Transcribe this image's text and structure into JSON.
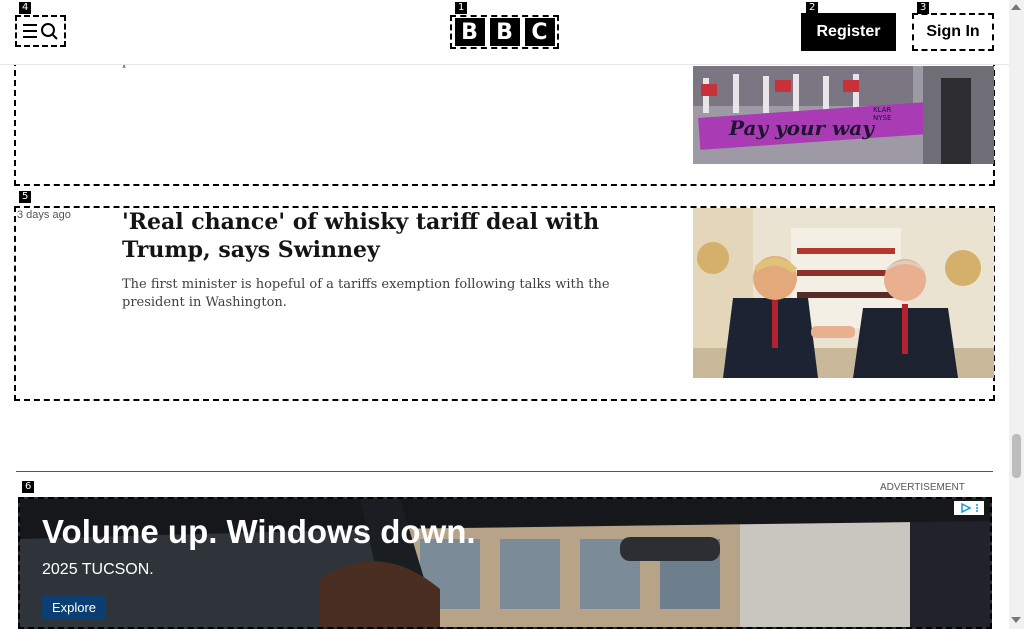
{
  "header": {
    "logo_letters": [
      "B",
      "B",
      "C"
    ],
    "register_label": "Register",
    "signin_label": "Sign In",
    "menu_icons": [
      "menu-icon",
      "search-icon"
    ]
  },
  "tags": {
    "logo": "1",
    "register": "2",
    "signin": "3",
    "menu": "4",
    "article2": "5",
    "ad": "6"
  },
  "articles": [
    {
      "summary_fragment": "p",
      "image_banner_text": "Pay your way",
      "image_sign_text": "KLAR NYSE"
    },
    {
      "time": "3 days ago",
      "headline": "'Real chance' of whisky tariff deal with Trump, says Swinney",
      "summary": "The first minister is hopeful of a tariffs exemption following talks with the president in Washington."
    }
  ],
  "ad": {
    "label": "ADVERTISEMENT",
    "headline": "Volume up. Windows down.",
    "subheadline": "2025 TUCSON.",
    "button_label": "Explore"
  },
  "colors": {
    "brand_black": "#000000",
    "ad_button": "#0b3e73",
    "banner_purple": "#a93bb5"
  }
}
